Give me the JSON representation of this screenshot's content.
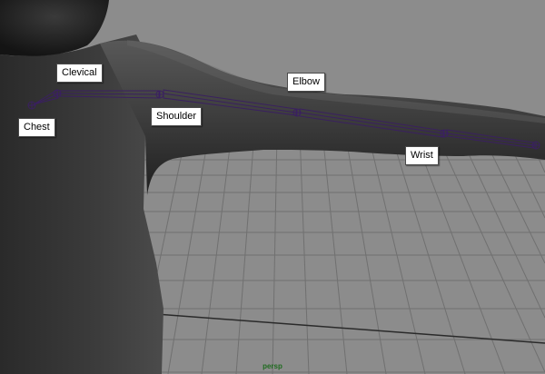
{
  "viewport": {
    "camera_name": "persp"
  },
  "joint_labels": {
    "clevical": "Clevical",
    "chest": "Chest",
    "shoulder": "Shoulder",
    "elbow": "Elbow",
    "wrist": "Wrist"
  },
  "colors": {
    "background": "#8c8c8c",
    "grid": "#6f6f6f",
    "model_light": "#5e5e5e",
    "model_dark": "#222222",
    "joint": "#3a2060",
    "camera_label": "#1f6b1f"
  }
}
